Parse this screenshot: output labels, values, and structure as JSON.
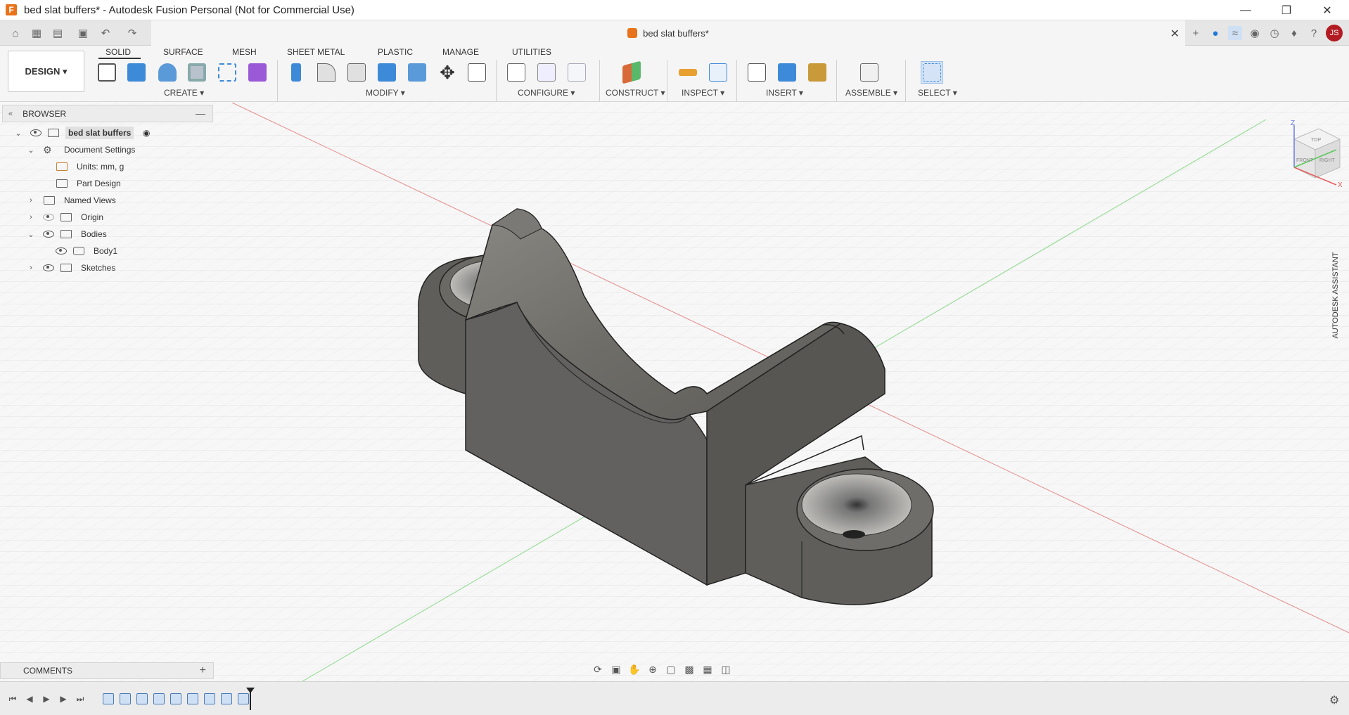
{
  "window": {
    "title": "bed slat buffers* - Autodesk Fusion Personal (Not for Commercial Use)",
    "app_icon_letter": "F"
  },
  "tab": {
    "label": "bed slat buffers*",
    "user_initials": "JS"
  },
  "ribbon": {
    "workspace": "DESIGN",
    "tabs": [
      "SOLID",
      "SURFACE",
      "MESH",
      "SHEET METAL",
      "PLASTIC",
      "MANAGE",
      "UTILITIES"
    ],
    "active_tab": "SOLID",
    "groups": [
      "CREATE",
      "MODIFY",
      "CONFIGURE",
      "CONSTRUCT",
      "INSPECT",
      "INSERT",
      "ASSEMBLE",
      "SELECT"
    ]
  },
  "browser": {
    "title": "BROWSER",
    "items": [
      {
        "label": "bed slat buffers"
      },
      {
        "label": "Document Settings"
      },
      {
        "label": "Units: mm, g"
      },
      {
        "label": "Part Design"
      },
      {
        "label": "Named Views"
      },
      {
        "label": "Origin"
      },
      {
        "label": "Bodies"
      },
      {
        "label": "Body1"
      },
      {
        "label": "Sketches"
      }
    ]
  },
  "comments": {
    "label": "COMMENTS"
  },
  "assistant": {
    "label": "AUTODESK ASSISTANT"
  },
  "viewcube": {
    "top": "TOP",
    "front": "FRONT",
    "right": "RIGHT",
    "axis_z": "Z",
    "axis_x": "X"
  },
  "colors": {
    "accent_orange": "#e8731c",
    "avatar_red": "#b31b22",
    "model_gray": "#6b6a66"
  }
}
